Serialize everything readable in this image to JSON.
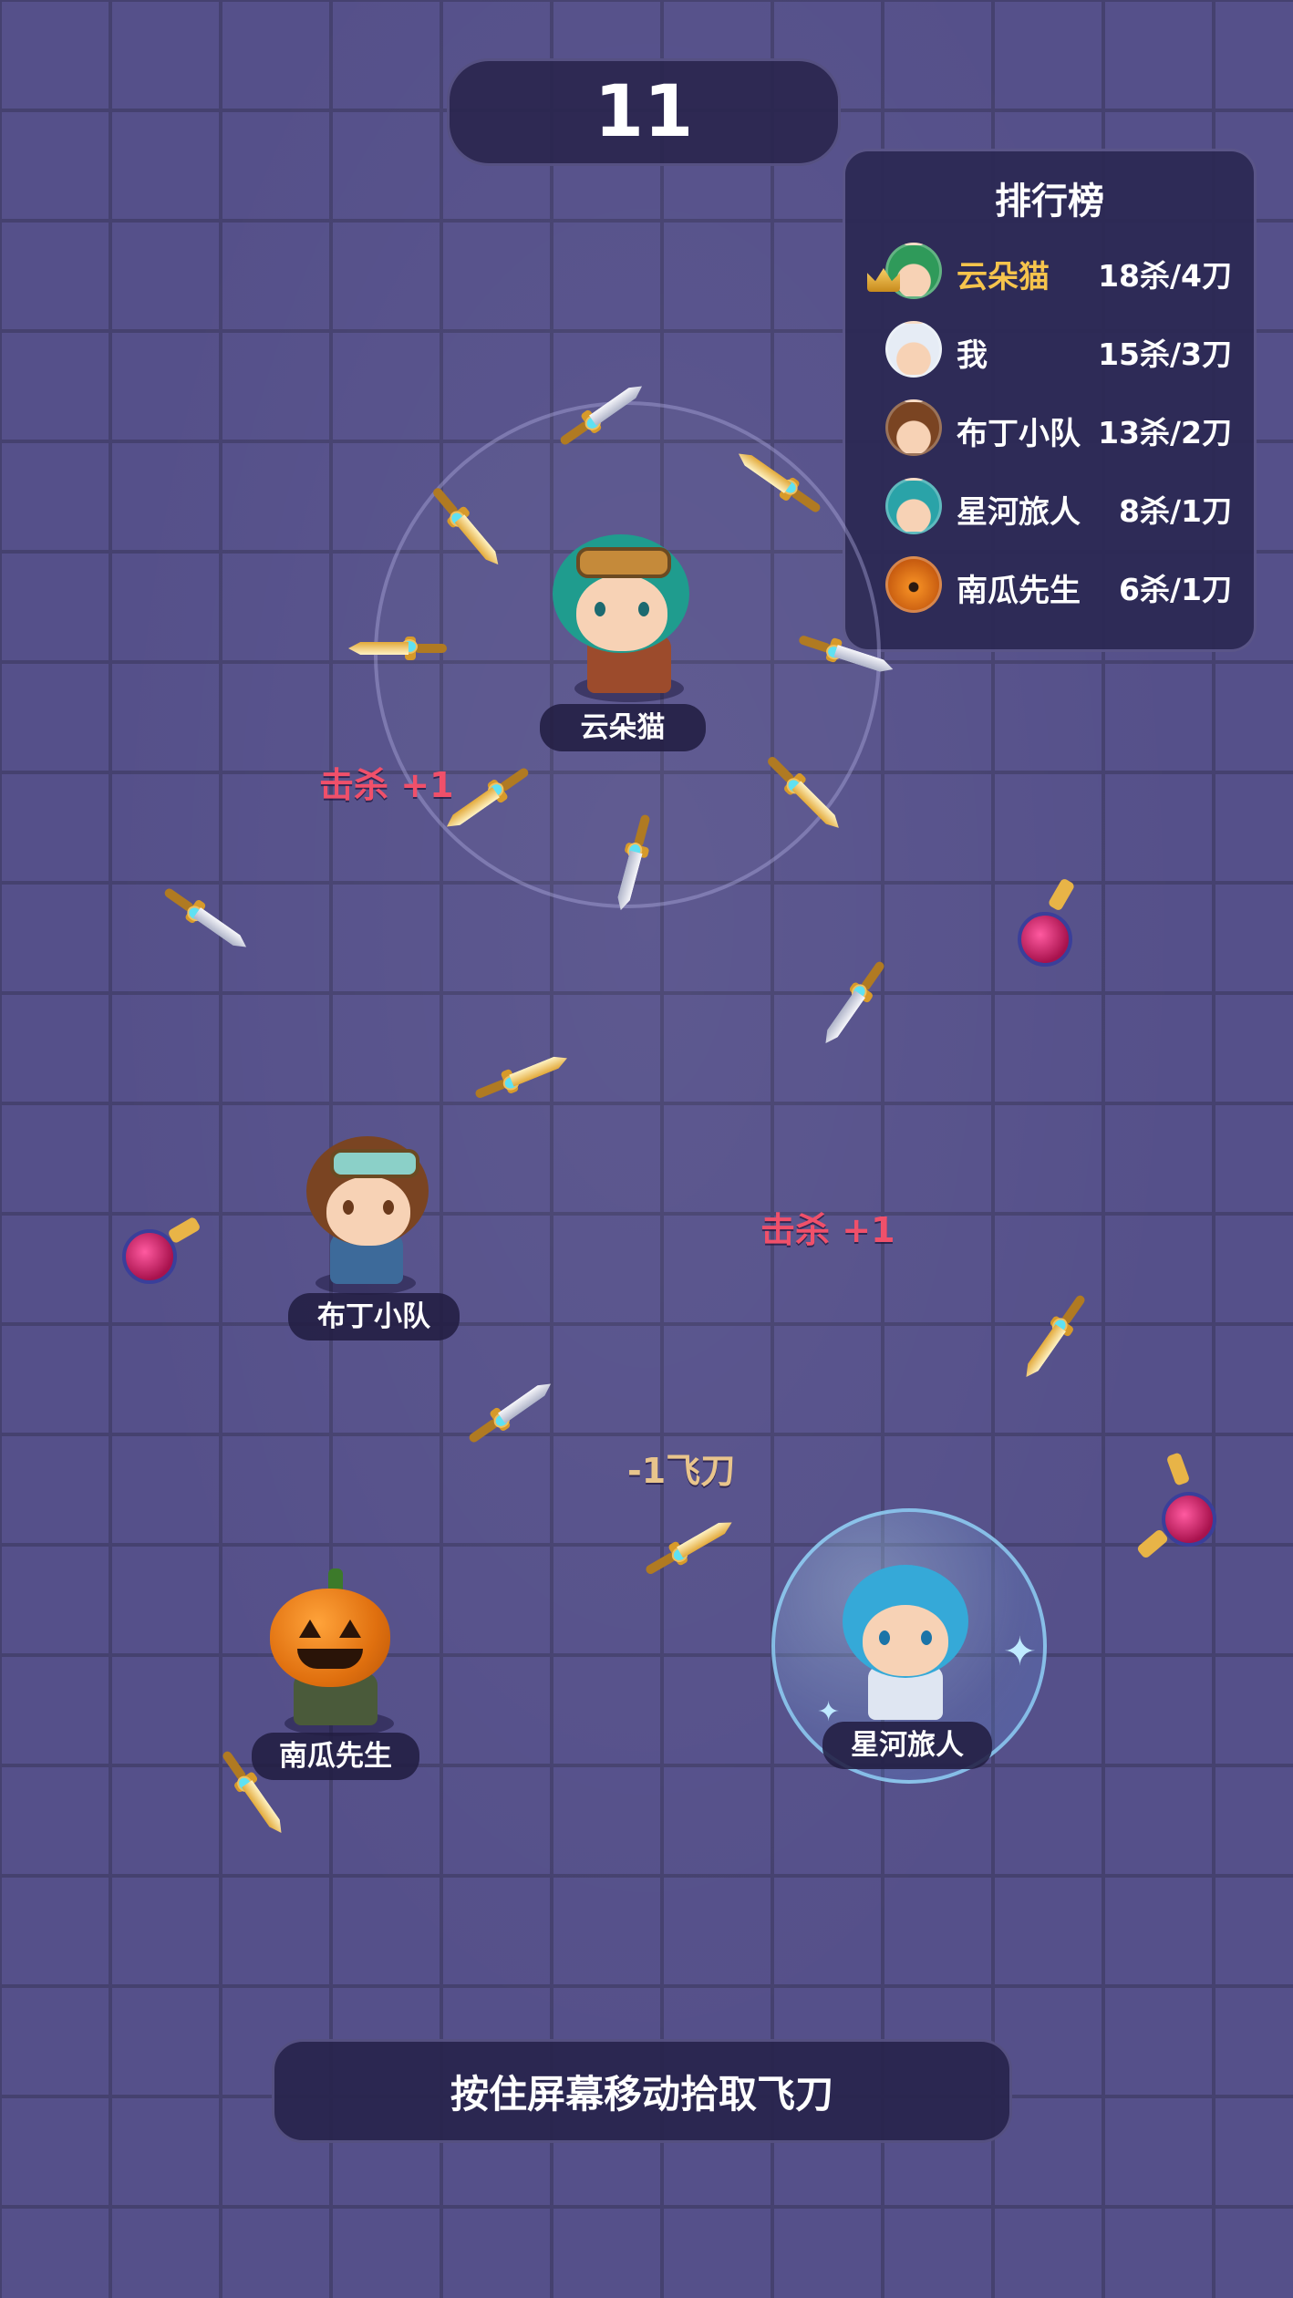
{
  "timer": "11",
  "leaderboard": {
    "title": "排行榜",
    "rows": [
      {
        "name": "云朵猫",
        "score": "18杀/4刀",
        "highlight": true,
        "avatar": "green-hair-goggles-icon"
      },
      {
        "name": "我",
        "score": "15杀/3刀",
        "highlight": false,
        "avatar": "white-hair-icon"
      },
      {
        "name": "布丁小队",
        "score": "13杀/2刀",
        "highlight": false,
        "avatar": "brown-hair-goggles-icon"
      },
      {
        "name": "星河旅人",
        "score": "8杀/1刀",
        "highlight": false,
        "avatar": "teal-hair-icon"
      },
      {
        "name": "南瓜先生",
        "score": "6杀/1刀",
        "highlight": false,
        "avatar": "pumpkin-icon"
      }
    ]
  },
  "players": {
    "yunduomao": {
      "name": "云朵猫",
      "hair": "#1f9c8e"
    },
    "budingxiaodui": {
      "name": "布丁小队",
      "hair": "#7a4422"
    },
    "nanguaxiansheng": {
      "name": "南瓜先生",
      "hair": "#e8801e"
    },
    "xingheluren": {
      "name": "星河旅人",
      "hair": "#35a9d8"
    }
  },
  "floating": {
    "kill_1": "击杀 +1",
    "kill_2": "击杀 +1",
    "minus_knife": "-1飞刀"
  },
  "hint": "按住屏幕移动拾取飞刀",
  "colors": {
    "kill_text": "#f0506a",
    "minus_text": "#e9c58c",
    "gold_name": "#f6c44c"
  }
}
